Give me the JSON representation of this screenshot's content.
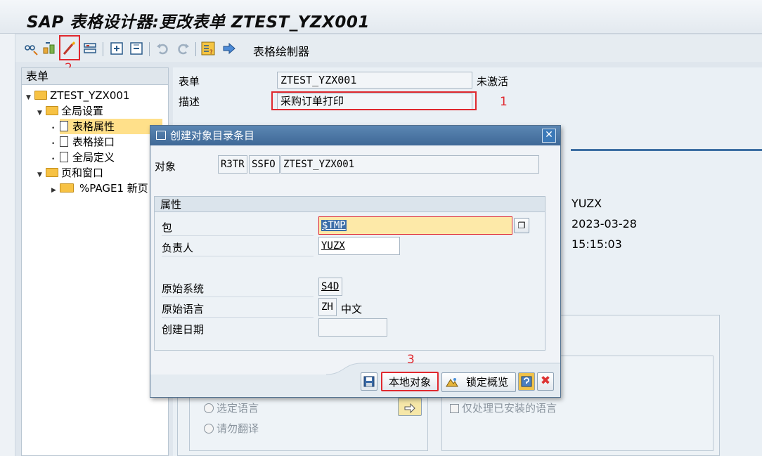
{
  "window": {
    "title": "SAP 表格设计器:更改表单 ZTEST_YZX001"
  },
  "toolbar": {
    "buttons": [
      "display-change-icon",
      "activate-icon",
      "test-icon",
      "form-interface-icon",
      "expand-icon",
      "collapse-icon",
      "undo-icon",
      "redo-icon",
      "field-list-icon",
      "form-painter-icon"
    ],
    "form_painter_label": "表格绘制器",
    "annotation_2": "2"
  },
  "tree": {
    "header": "表单",
    "root": "ZTEST_YZX001",
    "global_settings": "全局设置",
    "form_attributes": "表格属性",
    "form_interface": "表格接口",
    "global_definitions": "全局定义",
    "pages_windows": "页和窗口",
    "page1": "%PAGE1 新页"
  },
  "form": {
    "form_label": "表单",
    "form_value": "ZTEST_YZX001",
    "status": "未激活",
    "desc_label": "描述",
    "desc_value": "采购订单打印",
    "annotation_1": "1"
  },
  "right_panel": {
    "user": "YUZX",
    "date": "2023-03-28",
    "time": "15:15:03",
    "radio_selected_lang": "选定语言",
    "radio_no_translate": "请勿翻译",
    "checkbox_installed_only": "仅处理已安装的语言"
  },
  "dialog": {
    "title": "创建对象目录条目",
    "object_label": "对象",
    "object_pgmid": "R3TR",
    "object_type": "SSFO",
    "object_name": "ZTEST_YZX001",
    "attributes_header": "属性",
    "package_label": "包",
    "package_value": "$TMP",
    "owner_label": "负责人",
    "owner_value": "YUZX",
    "orig_system_label": "原始系统",
    "orig_system_value": "S4D",
    "orig_lang_label": "原始语言",
    "orig_lang_code": "ZH",
    "orig_lang_name": "中文",
    "created_on_label": "创建日期",
    "created_on_value": "",
    "local_object_button": "本地对象",
    "lock_overview_button": "锁定概览",
    "annotation_3": "3"
  },
  "colors": {
    "annotation_red": "#e0282e",
    "selected_tree_row": "#ffe08a",
    "dialog_title_blue": "#4a77a6",
    "package_field_highlight": "#fde9a8"
  }
}
